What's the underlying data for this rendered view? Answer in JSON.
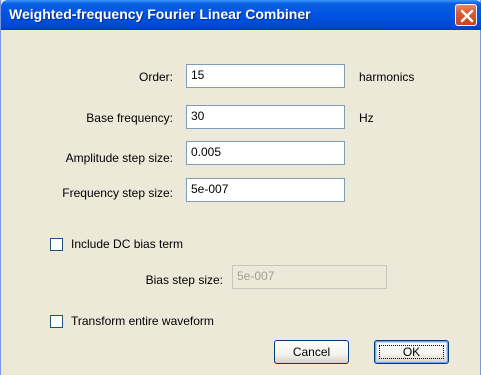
{
  "window": {
    "title": "Weighted-frequency Fourier Linear Combiner",
    "close_icon": "close-icon"
  },
  "fields": {
    "order": {
      "label": "Order:",
      "value": "15",
      "unit": "harmonics"
    },
    "base_frequency": {
      "label": "Base frequency:",
      "value": "30",
      "unit": "Hz"
    },
    "amplitude_step": {
      "label": "Amplitude step size:",
      "value": "0.005"
    },
    "frequency_step": {
      "label": "Frequency step size:",
      "value": "5e-007"
    }
  },
  "dc_bias": {
    "label": "Include DC bias term",
    "checked": false,
    "bias_step_label": "Bias step size:",
    "bias_step_value": "5e-007",
    "enabled": false
  },
  "transform": {
    "label": "Transform entire waveform",
    "checked": false
  },
  "buttons": {
    "cancel": "Cancel",
    "ok": "OK"
  },
  "colors": {
    "titlebar": "#0054e3",
    "dialog_bg": "#ece9d8",
    "close_button": "#d85a34"
  }
}
